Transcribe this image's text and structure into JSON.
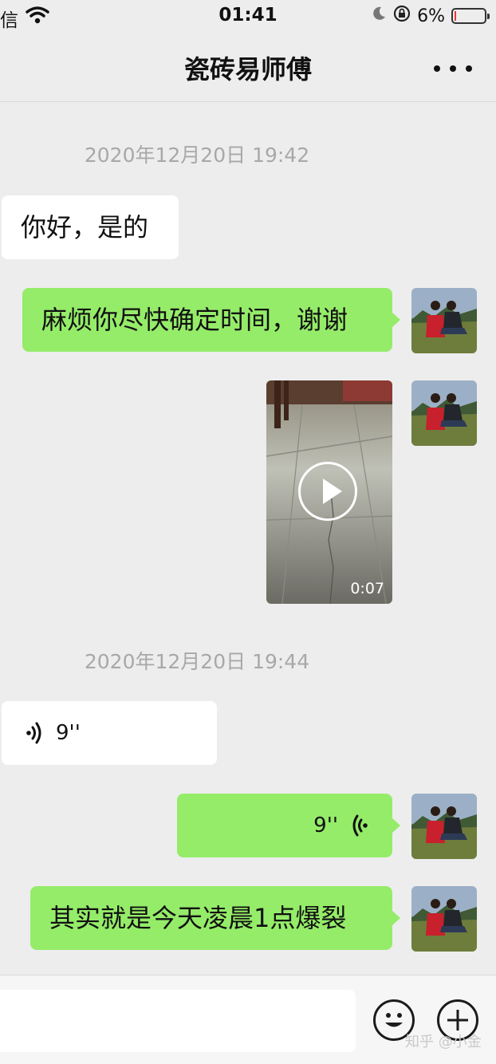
{
  "status_bar": {
    "carrier": "信",
    "time": "01:41",
    "battery": "6%",
    "battery_level": 0.06,
    "battery_color": "#e83a2f"
  },
  "chat": {
    "title": "瓷砖易师傅"
  },
  "colors": {
    "outgoing_bubble": "#95ec69",
    "incoming_bubble": "#ffffff",
    "background": "#ededed"
  },
  "messages": {
    "timestamp_1": "2020年12月20日 19:42",
    "msg_1": "你好，是的",
    "msg_2": "麻烦你尽快确定时间，谢谢",
    "video_duration": "0:07",
    "timestamp_2": "2020年12月20日 19:44",
    "voice_in_duration": "9''",
    "voice_out_duration": "9''",
    "msg_5": "其实就是今天凌晨1点爆裂"
  },
  "input_bar": {
    "placeholder": "",
    "emoji_icon": "smile-face-icon",
    "plus_icon": "plus-circle-icon"
  },
  "watermark": "知乎 @小金"
}
